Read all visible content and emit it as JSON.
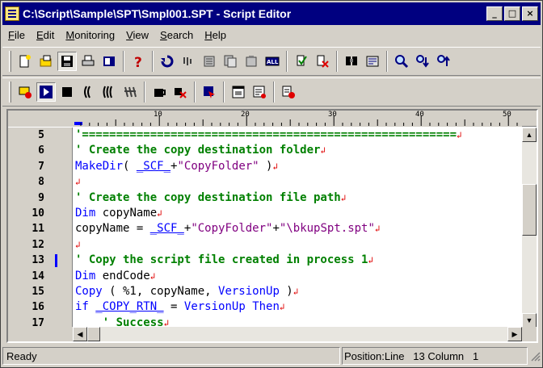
{
  "window": {
    "title": "C:\\Script\\Sample\\SPT\\Smpl001.SPT - Script Editor",
    "minimize": "_",
    "maximize": "□",
    "close": "×"
  },
  "menu": [
    {
      "label": "File",
      "accel": "F"
    },
    {
      "label": "Edit",
      "accel": "E"
    },
    {
      "label": "Monitoring",
      "accel": "M"
    },
    {
      "label": "View",
      "accel": "V"
    },
    {
      "label": "Search",
      "accel": "S"
    },
    {
      "label": "Help",
      "accel": "H"
    }
  ],
  "toolbar1": [
    "new-script-icon",
    "open-icon",
    "save-icon",
    "print-icon",
    "properties-icon",
    "help-icon",
    "undo-icon",
    "redo-icon",
    "paste-block-icon",
    "copy-block-icon",
    "delete-block-icon",
    "select-all-icon",
    "check-syntax-icon",
    "clear-check-icon",
    "find-icon",
    "replace-icon",
    "zoom-icon",
    "find-next-icon",
    "find-prev-icon"
  ],
  "toolbar2": [
    "monitor-icon",
    "run-icon",
    "stop-icon",
    "step-icon",
    "step-over-icon",
    "breakpoint-icon",
    "watch-icon",
    "clear-watch-icon",
    "trace-icon",
    "window-icon",
    "list-window-icon",
    "debug-icon"
  ],
  "ruler": {
    "marks": [
      "10",
      "20",
      "30",
      "40",
      "50"
    ]
  },
  "editor": {
    "line_numbers": [
      "5",
      "6",
      "7",
      "8",
      "9",
      "10",
      "11",
      "12",
      "13",
      "14",
      "15",
      "16",
      "17"
    ],
    "current_line": "13",
    "lines": [
      [
        {
          "t": "'=======================================================",
          "c": "c-comment"
        }
      ],
      [
        {
          "t": "' Create the copy destination folder",
          "c": "c-comment"
        }
      ],
      [
        {
          "t": "MakeDir",
          "c": "c-kw"
        },
        {
          "t": "( ",
          "c": "c-norm"
        },
        {
          "t": "_SCF_",
          "c": "c-const"
        },
        {
          "t": "+",
          "c": "c-norm"
        },
        {
          "t": "\"CopyFolder\"",
          "c": "c-str"
        },
        {
          "t": " )",
          "c": "c-norm"
        }
      ],
      [],
      [
        {
          "t": "' Create the copy destination file path",
          "c": "c-comment"
        }
      ],
      [
        {
          "t": "Dim",
          "c": "c-kw"
        },
        {
          "t": " copyName",
          "c": "c-norm"
        }
      ],
      [
        {
          "t": "copyName = ",
          "c": "c-norm"
        },
        {
          "t": "_SCF_",
          "c": "c-const"
        },
        {
          "t": "+",
          "c": "c-norm"
        },
        {
          "t": "\"CopyFolder\"",
          "c": "c-str"
        },
        {
          "t": "+",
          "c": "c-norm"
        },
        {
          "t": "\"\\bkupSpt.spt\"",
          "c": "c-str"
        }
      ],
      [],
      [
        {
          "t": "' Copy the script file created in process 1",
          "c": "c-comment"
        }
      ],
      [
        {
          "t": "Dim",
          "c": "c-kw"
        },
        {
          "t": " endCode",
          "c": "c-norm"
        }
      ],
      [
        {
          "t": "Copy",
          "c": "c-kw"
        },
        {
          "t": " ( %1, copyName, ",
          "c": "c-norm"
        },
        {
          "t": "VersionUp",
          "c": "c-kw"
        },
        {
          "t": " )",
          "c": "c-norm"
        }
      ],
      [
        {
          "t": "if",
          "c": "c-kw"
        },
        {
          "t": " ",
          "c": "c-norm"
        },
        {
          "t": "_COPY_RTN_",
          "c": "c-const"
        },
        {
          "t": " = ",
          "c": "c-norm"
        },
        {
          "t": "VersionUp",
          "c": "c-kw"
        },
        {
          "t": " ",
          "c": "c-norm"
        },
        {
          "t": "Then",
          "c": "c-kw"
        }
      ],
      [
        {
          "t": "    ' Success",
          "c": "c-comment"
        }
      ]
    ],
    "eol_mark": "↲"
  },
  "status": {
    "ready": "Ready",
    "position": "Position:Line   13 Column   1"
  }
}
